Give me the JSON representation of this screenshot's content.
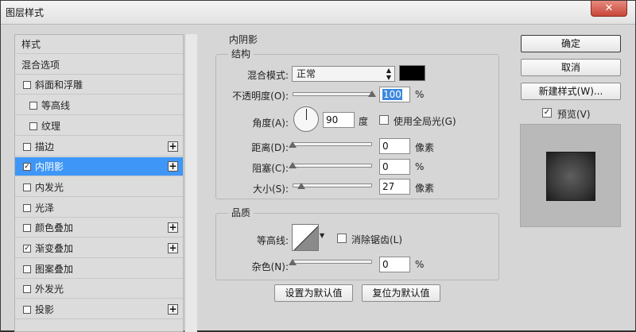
{
  "window": {
    "title": "图层样式",
    "close_label": "✕"
  },
  "styles_list": {
    "items": [
      {
        "label": "样式",
        "has_checkbox": false,
        "checked": false,
        "has_plus": false,
        "selected": false,
        "indent": 0
      },
      {
        "label": "混合选项",
        "has_checkbox": false,
        "checked": false,
        "has_plus": false,
        "selected": false,
        "indent": 0
      },
      {
        "label": "斜面和浮雕",
        "has_checkbox": true,
        "checked": false,
        "has_plus": false,
        "selected": false,
        "indent": 0
      },
      {
        "label": "等高线",
        "has_checkbox": true,
        "checked": false,
        "has_plus": false,
        "selected": false,
        "indent": 1
      },
      {
        "label": "纹理",
        "has_checkbox": true,
        "checked": false,
        "has_plus": false,
        "selected": false,
        "indent": 1
      },
      {
        "label": "描边",
        "has_checkbox": true,
        "checked": false,
        "has_plus": true,
        "selected": false,
        "indent": 0
      },
      {
        "label": "内阴影",
        "has_checkbox": true,
        "checked": true,
        "has_plus": true,
        "selected": true,
        "indent": 0
      },
      {
        "label": "内发光",
        "has_checkbox": true,
        "checked": false,
        "has_plus": false,
        "selected": false,
        "indent": 0
      },
      {
        "label": "光泽",
        "has_checkbox": true,
        "checked": false,
        "has_plus": false,
        "selected": false,
        "indent": 0
      },
      {
        "label": "颜色叠加",
        "has_checkbox": true,
        "checked": false,
        "has_plus": true,
        "selected": false,
        "indent": 0
      },
      {
        "label": "渐变叠加",
        "has_checkbox": true,
        "checked": true,
        "has_plus": true,
        "selected": false,
        "indent": 0
      },
      {
        "label": "图案叠加",
        "has_checkbox": true,
        "checked": false,
        "has_plus": false,
        "selected": false,
        "indent": 0
      },
      {
        "label": "外发光",
        "has_checkbox": true,
        "checked": false,
        "has_plus": false,
        "selected": false,
        "indent": 0
      },
      {
        "label": "投影",
        "has_checkbox": true,
        "checked": false,
        "has_plus": true,
        "selected": false,
        "indent": 0
      }
    ]
  },
  "inner_shadow": {
    "section_title": "内阴影",
    "structure": {
      "title": "结构",
      "blend_mode_label": "混合模式:",
      "blend_mode_value": "正常",
      "shadow_color": "#000000",
      "opacity_label": "不透明度(O):",
      "opacity_value": "100",
      "opacity_unit": "%",
      "angle_label": "角度(A):",
      "angle_value": "90",
      "angle_unit": "度",
      "global_light_label": "使用全局光(G)",
      "global_light_checked": false,
      "distance_label": "距离(D):",
      "distance_value": "0",
      "distance_unit": "像素",
      "choke_label": "阻塞(C):",
      "choke_value": "0",
      "choke_unit": "%",
      "size_label": "大小(S):",
      "size_value": "27",
      "size_unit": "像素"
    },
    "quality": {
      "title": "品质",
      "contour_label": "等高线:",
      "anti_alias_label": "消除锯齿(L)",
      "anti_alias_checked": false,
      "noise_label": "杂色(N):",
      "noise_value": "0",
      "noise_unit": "%"
    },
    "make_default_label": "设置为默认值",
    "reset_default_label": "复位为默认值"
  },
  "actions": {
    "ok_label": "确定",
    "cancel_label": "取消",
    "new_style_label": "新建样式(W)...",
    "preview_label": "预览(V)",
    "preview_checked": true
  }
}
